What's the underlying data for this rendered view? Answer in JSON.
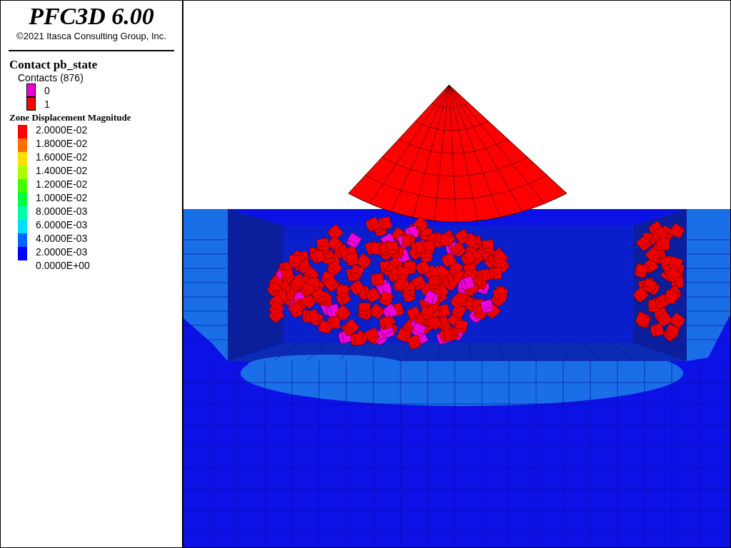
{
  "header": {
    "title": "PFC3D 6.00",
    "copyright": "©2021 Itasca Consulting Group, Inc."
  },
  "contact_legend": {
    "title": "Contact pb_state",
    "subtitle": "Contacts (876)",
    "items": [
      {
        "label": "0",
        "color": "#ee00dd"
      },
      {
        "label": "1",
        "color": "#ff0000"
      }
    ]
  },
  "zone_legend": {
    "title": "Zone Displacement Magnitude",
    "labels": [
      "2.0000E-02",
      "1.8000E-02",
      "1.6000E-02",
      "1.4000E-02",
      "1.2000E-02",
      "1.0000E-02",
      "8.0000E-03",
      "6.0000E-03",
      "4.0000E-03",
      "2.0000E-03",
      "0.0000E+00"
    ],
    "bands": [
      {
        "color": "#ff0000"
      },
      {
        "color": "#ff6f00"
      },
      {
        "color": "#ffe000"
      },
      {
        "color": "#aaff00"
      },
      {
        "color": "#44ff00"
      },
      {
        "color": "#00ff40"
      },
      {
        "color": "#00ffaa"
      },
      {
        "color": "#00ddff"
      },
      {
        "color": "#0066ff"
      },
      {
        "color": "#0000ff"
      }
    ]
  }
}
